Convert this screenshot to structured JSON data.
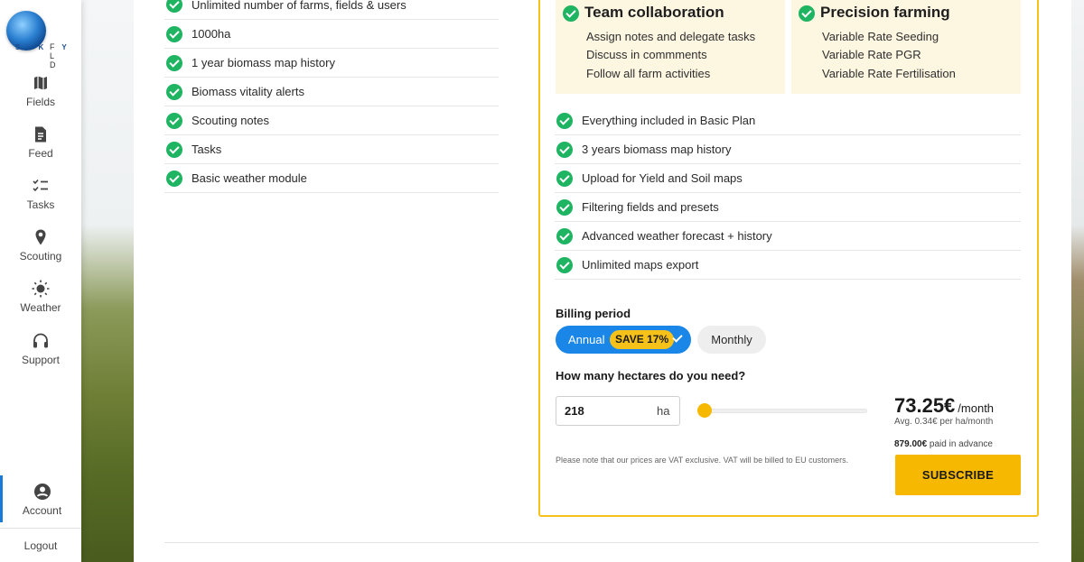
{
  "brand": {
    "logo_left": "S K Y",
    "logo_right": "F L D"
  },
  "sidebar": {
    "items": [
      {
        "label": "Fields",
        "icon": "map-icon"
      },
      {
        "label": "Feed",
        "icon": "document-icon"
      },
      {
        "label": "Tasks",
        "icon": "checklist-icon"
      },
      {
        "label": "Scouting",
        "icon": "pin-icon"
      },
      {
        "label": "Weather",
        "icon": "sun-icon"
      },
      {
        "label": "Support",
        "icon": "headset-icon"
      }
    ],
    "account": "Account",
    "logout": "Logout"
  },
  "basic_features": [
    "Unlimited number of farms, fields & users",
    "1000ha",
    "1 year biomass map history",
    "Biomass vitality alerts",
    "Scouting notes",
    "Tasks",
    "Basic weather module"
  ],
  "plan": {
    "cards": [
      {
        "title": "Team collaboration",
        "lines": [
          "Assign notes and delegate tasks",
          "Discuss in commments",
          "Follow all farm activities"
        ]
      },
      {
        "title": "Precision farming",
        "lines": [
          "Variable Rate Seeding",
          "Variable Rate PGR",
          "Variable Rate Fertilisation"
        ]
      }
    ],
    "features": [
      "Everything included in Basic Plan",
      "3 years biomass map history",
      "Upload for Yield and Soil maps",
      "Filtering fields and presets",
      "Advanced weather forecast + history",
      "Unlimited maps export"
    ],
    "billing_label": "Billing period",
    "annual_label": "Annual",
    "save_badge": "SAVE 17%",
    "monthly_label": "Monthly",
    "hectares_question": "How many hectares do you need?",
    "hectares_value": "218",
    "hectares_unit": "ha",
    "slider_fraction": 0.02,
    "price": "73.25€",
    "per_month": "/month",
    "avg": "Avg. 0.34€ per ha/month",
    "advance_amount": "879.00€",
    "advance_text": " paid in advance",
    "vat_note": "Please note that our prices are VAT exclusive. VAT will be billed to EU customers.",
    "subscribe_label": "SUBSCRIBE"
  },
  "colors": {
    "accent": "#1a86e8",
    "highlight": "#f6c21a",
    "check": "#1fb462",
    "card_bg": "#fdf6e1"
  }
}
